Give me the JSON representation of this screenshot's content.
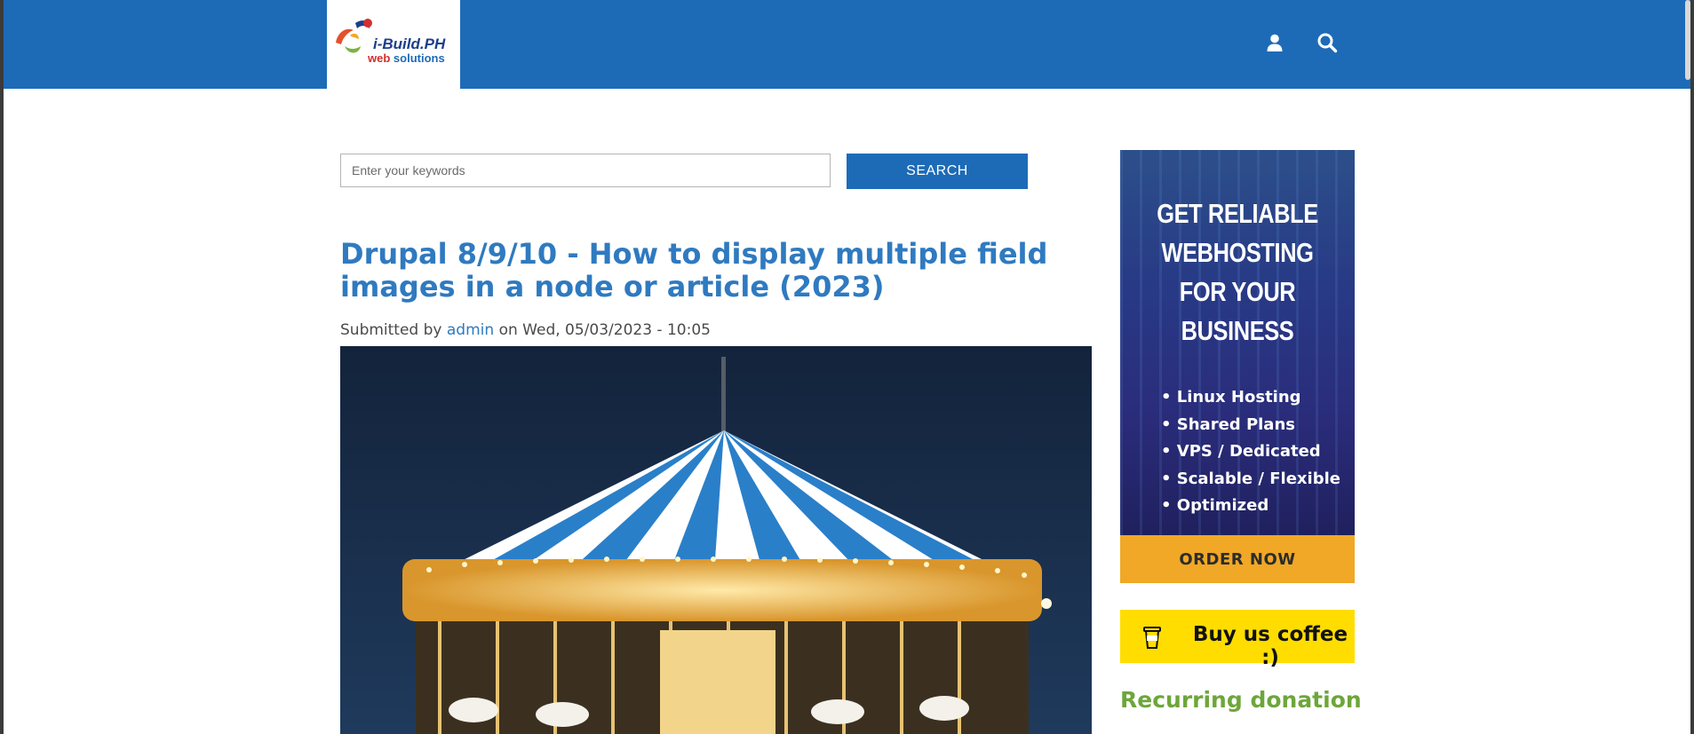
{
  "header": {
    "logo_line1": "i-Build.PH",
    "logo_line2_part1": "web",
    "logo_line2_part2": "solutions",
    "user_icon": "user-icon",
    "search_icon": "search-icon",
    "bar_color": "#1d6bb7"
  },
  "search": {
    "placeholder": "Enter your keywords",
    "value": "",
    "button_label": "SEARCH"
  },
  "article": {
    "title": "Drupal 8/9/10 - How to display multiple field images in a node or article (2023)",
    "submitted_prefix": "Submitted by",
    "author": "admin",
    "date_prefix": "on",
    "date": "Wed, 05/03/2023 - 10:05"
  },
  "sidebar": {
    "ad": {
      "headline": [
        "GET RELIABLE",
        "WEBHOSTING",
        "FOR YOUR",
        "BUSINESS"
      ],
      "features": [
        "Linux Hosting",
        "Shared Plans",
        "VPS / Dedicated",
        "Scalable / Flexible",
        "Optimized"
      ],
      "cta": "ORDER NOW",
      "cta_color": "#f0a826"
    },
    "coffee": {
      "label": "Buy us coffee :)",
      "icon": "coffee-cup-icon",
      "color": "#ffdd00"
    },
    "donation_heading": "Recurring donation"
  }
}
